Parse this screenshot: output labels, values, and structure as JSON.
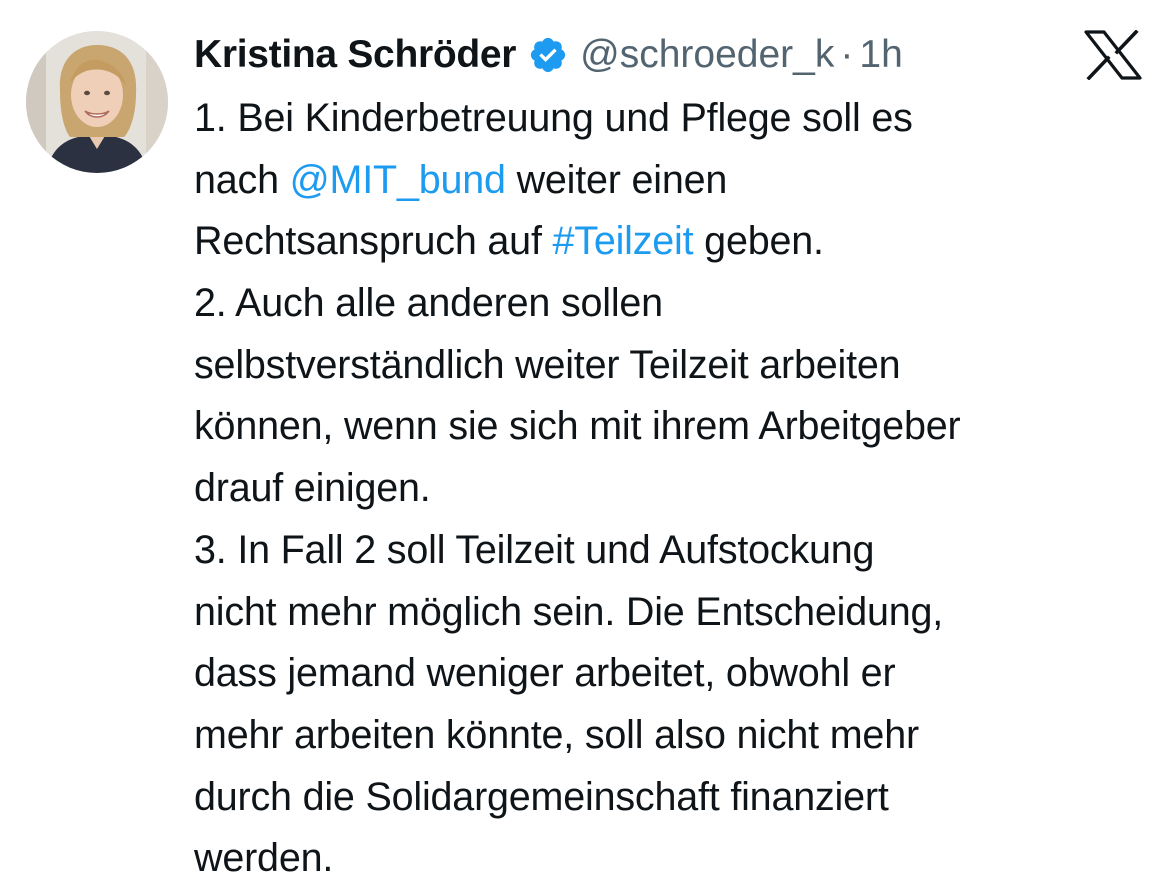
{
  "author": {
    "display_name": "Kristina Schröder",
    "verified_icon": "verified-badge-icon",
    "handle": "@schroeder_k",
    "separator": "·",
    "time": "1h",
    "avatar": "avatar-photo"
  },
  "platform_logo": "x-logo-icon",
  "colors": {
    "link": "#1d9bf0",
    "text": "#0f1419",
    "secondary": "#536471"
  },
  "tweet": {
    "lines": [
      [
        {
          "text": "1. Bei Kinderbetreuung und Pflege soll es",
          "link": false
        }
      ],
      [
        {
          "text": "nach ",
          "link": false
        },
        {
          "text": "@MIT_bund",
          "link": true
        },
        {
          "text": " weiter einen",
          "link": false
        }
      ],
      [
        {
          "text": "Rechtsanspruch auf ",
          "link": false
        },
        {
          "text": "#Teilzeit",
          "link": true
        },
        {
          "text": " geben.",
          "link": false
        }
      ],
      [
        {
          "text": "2. Auch alle anderen sollen",
          "link": false
        }
      ],
      [
        {
          "text": "selbstverständlich weiter Teilzeit arbeiten",
          "link": false
        }
      ],
      [
        {
          "text": "können, wenn sie sich mit ihrem Arbeitgeber",
          "link": false
        }
      ],
      [
        {
          "text": "drauf einigen.",
          "link": false
        }
      ],
      [
        {
          "text": "3. In Fall 2 soll Teilzeit und Aufstockung",
          "link": false
        }
      ],
      [
        {
          "text": "nicht mehr möglich sein. Die Entscheidung,",
          "link": false
        }
      ],
      [
        {
          "text": "dass jemand weniger arbeitet, obwohl er",
          "link": false
        }
      ],
      [
        {
          "text": "mehr arbeiten könnte, soll also nicht mehr",
          "link": false
        }
      ],
      [
        {
          "text": "durch die Solidargemeinschaft finanziert",
          "link": false
        }
      ],
      [
        {
          "text": "werden.",
          "link": false
        }
      ]
    ]
  }
}
